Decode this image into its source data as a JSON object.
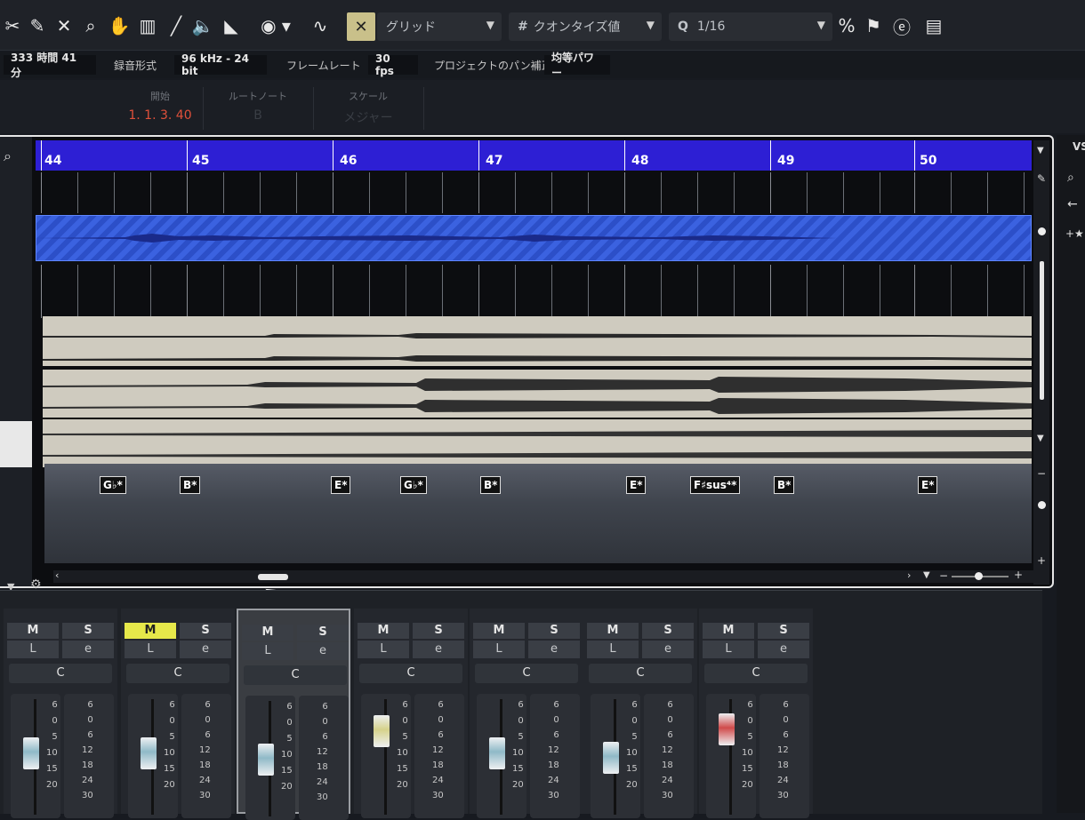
{
  "toolbar": {
    "snap_type": "グリッド",
    "quantize_label": "クオンタイズ値",
    "quantize_value": "1/16"
  },
  "infobar": {
    "record_time": "333 時間 41 分",
    "record_format_label": "録音形式",
    "record_format_value": "96 kHz - 24 bit",
    "frame_rate_label": "フレームレート",
    "frame_rate_value": "30 fps",
    "pan_law_label": "プロジェクトのパン補正",
    "pan_law_value": "均等パワー"
  },
  "event_info": {
    "start_label": "開始",
    "start_value": "1. 1. 3. 40",
    "root_note_label": "ルートノート",
    "root_note_value": "B",
    "scale_label": "スケール",
    "scale_value": "メジャー"
  },
  "ruler": {
    "bars": [
      "44",
      "45",
      "46",
      "47",
      "48",
      "49",
      "50"
    ]
  },
  "chords": [
    {
      "label": "G♭*"
    },
    {
      "label": "B*"
    },
    {
      "label": "E*"
    },
    {
      "label": "G♭*"
    },
    {
      "label": "B*"
    },
    {
      "label": "E*"
    },
    {
      "label": "F♯sus⁴*"
    },
    {
      "label": "B*"
    },
    {
      "label": "E*"
    }
  ],
  "side_panel": {
    "title": "VS"
  },
  "mixer": {
    "channels": [
      {
        "mute": "M",
        "solo": "S",
        "listen": "L",
        "edit": "e",
        "pan": "C",
        "mute_active": false,
        "selected": false,
        "fader_level": 0.55,
        "fader_color": "#8fb9c7"
      },
      {
        "mute": "M",
        "solo": "S",
        "listen": "L",
        "edit": "e",
        "pan": "C",
        "mute_active": true,
        "selected": false,
        "fader_level": 0.55,
        "fader_color": "#8fb9c7"
      },
      {
        "mute": "M",
        "solo": "S",
        "listen": "L",
        "edit": "e",
        "pan": "C",
        "mute_active": false,
        "selected": true,
        "fader_level": 0.5,
        "fader_color": "#8fb9c7"
      },
      {
        "mute": "M",
        "solo": "S",
        "listen": "L",
        "edit": "e",
        "pan": "C",
        "mute_active": false,
        "selected": false,
        "fader_level": 0.8,
        "fader_color": "#d6d28a"
      },
      {
        "mute": "M",
        "solo": "S",
        "listen": "L",
        "edit": "e",
        "pan": "C",
        "mute_active": false,
        "selected": false,
        "fader_level": 0.55,
        "fader_color": "#8fb9c7"
      },
      {
        "mute": "M",
        "solo": "S",
        "listen": "L",
        "edit": "e",
        "pan": "C",
        "mute_active": false,
        "selected": false,
        "fader_level": 0.5,
        "fader_color": "#8fb9c7"
      },
      {
        "mute": "M",
        "solo": "S",
        "listen": "L",
        "edit": "e",
        "pan": "C",
        "mute_active": false,
        "selected": false,
        "fader_level": 0.82,
        "fader_color": "#d04a4a"
      }
    ],
    "fader_scale": [
      "6",
      "0",
      "5",
      "10",
      "15",
      "20"
    ],
    "meter_scale": [
      "6",
      "0",
      "6",
      "12",
      "18",
      "24",
      "30"
    ]
  }
}
